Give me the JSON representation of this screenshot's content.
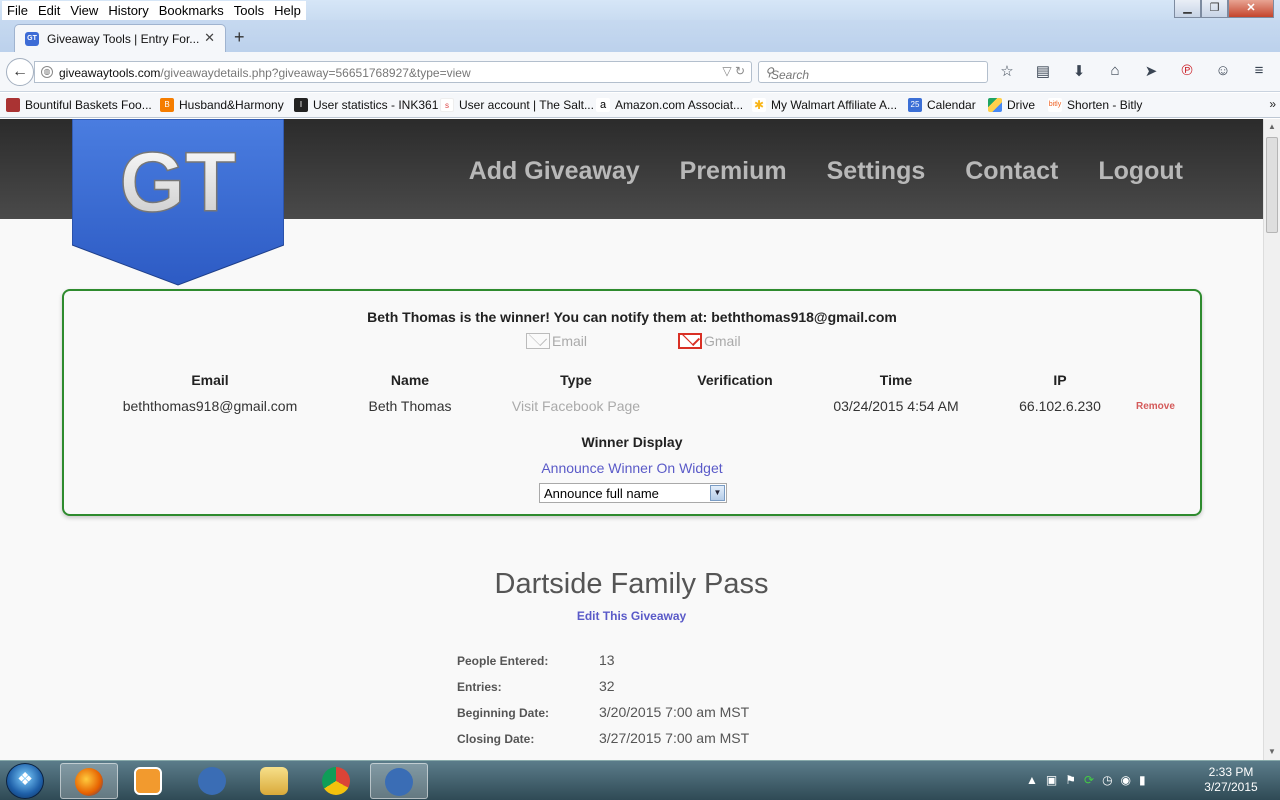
{
  "browser": {
    "menu": [
      "File",
      "Edit",
      "View",
      "History",
      "Bookmarks",
      "Tools",
      "Help"
    ],
    "tab_title": "Giveaway Tools | Entry For...",
    "url_host": "giveawaytools.com",
    "url_path": "/giveawaydetails.php?giveaway=56651768927&type=view",
    "search_placeholder": "Search",
    "bookmarks": [
      "Bountiful Baskets Foo...",
      "Husband&Harmony",
      "User statistics - INK361",
      "User account | The Salt...",
      "Amazon.com Associat...",
      "My Walmart Affiliate A...",
      "Calendar",
      "Drive",
      "Shorten - Bitly"
    ]
  },
  "site": {
    "logo_text": "GT",
    "nav": [
      "Add Giveaway",
      "Premium",
      "Settings",
      "Contact",
      "Logout"
    ]
  },
  "winner": {
    "headline": "Beth Thomas is the winner! You can notify them at: beththomas918@gmail.com",
    "email_link": "Email",
    "gmail_link": "Gmail",
    "columns": [
      "Email",
      "Name",
      "Type",
      "Verification",
      "Time",
      "IP"
    ],
    "row": {
      "email": "beththomas918@gmail.com",
      "name": "Beth Thomas",
      "type": "Visit Facebook Page",
      "verification": "",
      "time": "03/24/2015 4:54 AM",
      "ip": "66.102.6.230"
    },
    "remove": "Remove",
    "display_heading": "Winner Display",
    "announce_link": "Announce Winner On Widget",
    "select_value": "Announce full name"
  },
  "giveaway": {
    "title": "Dartside Family Pass",
    "edit_link": "Edit This Giveaway",
    "stats": [
      {
        "label": "People Entered:",
        "value": "13"
      },
      {
        "label": "Entries:",
        "value": "32"
      },
      {
        "label": "Beginning Date:",
        "value": "3/20/2015 7:00 am MST"
      },
      {
        "label": "Closing Date:",
        "value": "3/27/2015 7:00 am MST"
      }
    ]
  },
  "taskbar": {
    "time": "2:33 PM",
    "date": "3/27/2015"
  }
}
